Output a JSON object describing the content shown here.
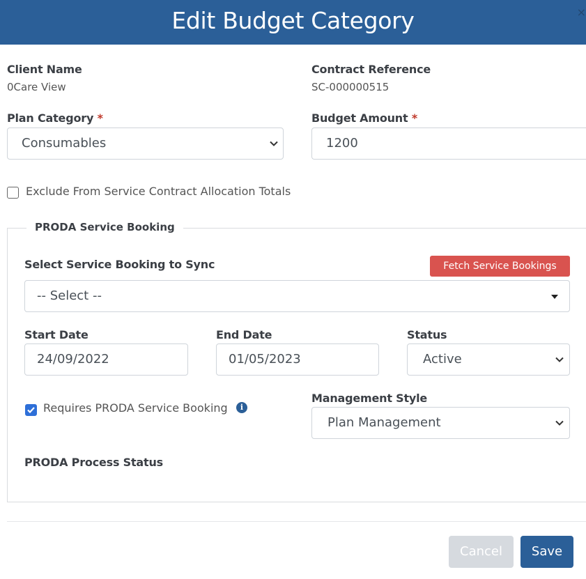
{
  "modal": {
    "title": "Edit Budget Category",
    "close": "×"
  },
  "client": {
    "label": "Client Name",
    "value": "0Care View"
  },
  "contract": {
    "label": "Contract Reference",
    "value": "SC-000000515"
  },
  "plan_category": {
    "label": "Plan Category",
    "required_mark": "*",
    "value": "Consumables"
  },
  "budget_amount": {
    "label": "Budget Amount",
    "required_mark": "*",
    "value": "1200"
  },
  "exclude": {
    "label": "Exclude From Service Contract Allocation Totals",
    "checked": false
  },
  "proda": {
    "legend": "PRODA Service Booking",
    "select_booking": {
      "label": "Select Service Booking to Sync",
      "value": "-- Select --"
    },
    "fetch_button": "Fetch Service Bookings",
    "start_date": {
      "label": "Start Date",
      "value": "24/09/2022"
    },
    "end_date": {
      "label": "End Date",
      "value": "01/05/2023"
    },
    "status": {
      "label": "Status",
      "value": "Active"
    },
    "requires": {
      "label": "Requires PRODA Service Booking",
      "checked": true,
      "info_icon": "i"
    },
    "management_style": {
      "label": "Management Style",
      "value": "Plan Management"
    },
    "process_status": {
      "label": "PRODA Process Status"
    }
  },
  "footer": {
    "cancel": "Cancel",
    "save": "Save"
  },
  "colors": {
    "header": "#2b5f98",
    "danger": "#d9534f",
    "primary": "#2b5f98",
    "disabled": "#d6dadf"
  }
}
